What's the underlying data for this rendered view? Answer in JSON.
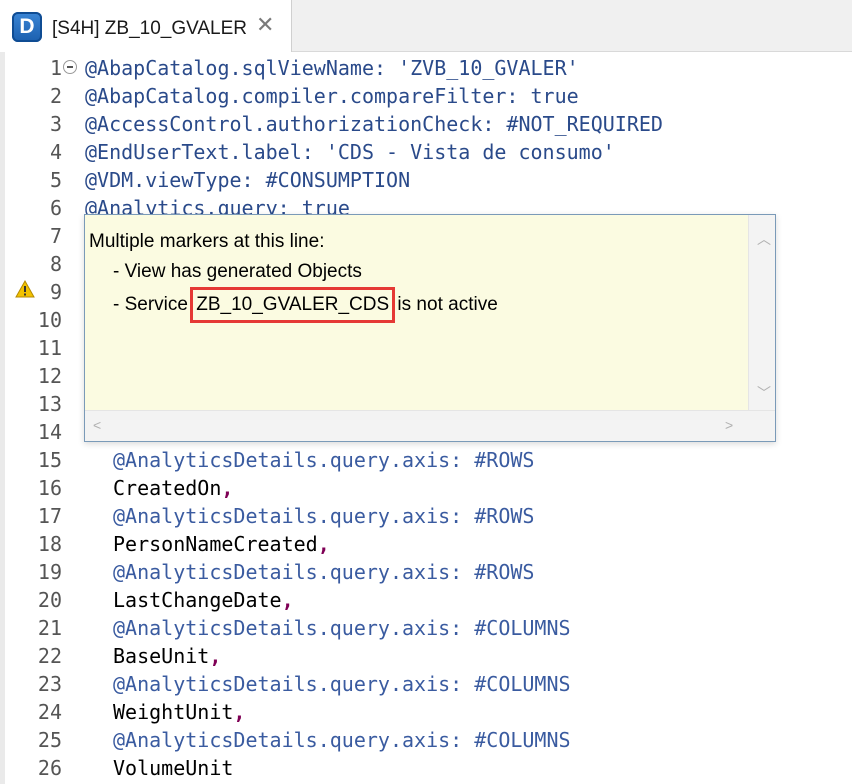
{
  "tab": {
    "icon": "D",
    "title": "[S4H] ZB_10_GVALER",
    "close": "✕"
  },
  "lines": [
    {
      "n": "1",
      "text": "@AbapCatalog.sqlViewName: 'ZVB_10_GVALER'",
      "indent": false
    },
    {
      "n": "2",
      "text": "@AbapCatalog.compiler.compareFilter: true",
      "indent": false
    },
    {
      "n": "3",
      "text": "@AccessControl.authorizationCheck: #NOT_REQUIRED",
      "indent": false
    },
    {
      "n": "4",
      "text": "@EndUserText.label: 'CDS - Vista de consumo'",
      "indent": false
    },
    {
      "n": "5",
      "text": "@VDM.viewType: #CONSUMPTION",
      "indent": false
    },
    {
      "n": "6",
      "text": "@Analytics.query: true",
      "indent": false
    },
    {
      "n": "7",
      "text": "",
      "indent": false
    },
    {
      "n": "8",
      "text": "",
      "indent": false
    },
    {
      "n": "9",
      "text": "",
      "indent": false
    },
    {
      "n": "10",
      "text": "",
      "indent": false
    },
    {
      "n": "11",
      "text": "",
      "indent": false
    },
    {
      "n": "12",
      "text": "",
      "indent": false
    },
    {
      "n": "13",
      "text": "",
      "indent": false
    },
    {
      "n": "14",
      "text": "",
      "indent": false
    },
    {
      "n": "15",
      "text": "@AnalyticsDetails.query.axis: #ROWS",
      "indent": true,
      "ann": true
    },
    {
      "n": "16",
      "text": "CreatedOn",
      "comma": ",",
      "indent": true
    },
    {
      "n": "17",
      "text": "@AnalyticsDetails.query.axis: #ROWS",
      "indent": true,
      "ann": true
    },
    {
      "n": "18",
      "text": "PersonNameCreated",
      "comma": ",",
      "indent": true
    },
    {
      "n": "19",
      "text": "@AnalyticsDetails.query.axis: #ROWS",
      "indent": true,
      "ann": true
    },
    {
      "n": "20",
      "text": "LastChangeDate",
      "comma": ",",
      "indent": true
    },
    {
      "n": "21",
      "text": "@AnalyticsDetails.query.axis: #COLUMNS",
      "indent": true,
      "ann": true
    },
    {
      "n": "22",
      "text": "BaseUnit",
      "comma": ",",
      "indent": true
    },
    {
      "n": "23",
      "text": "@AnalyticsDetails.query.axis: #COLUMNS",
      "indent": true,
      "ann": true
    },
    {
      "n": "24",
      "text": "WeightUnit",
      "comma": ",",
      "indent": true
    },
    {
      "n": "25",
      "text": "@AnalyticsDetails.query.axis: #COLUMNS",
      "indent": true,
      "ann": true
    },
    {
      "n": "26",
      "text": "VolumeUnit",
      "indent": true
    }
  ],
  "popup": {
    "heading": "Multiple markers at this line:",
    "item1": "- View has generated Objects",
    "item2_prefix": "- Service ",
    "item2_highlight": "ZB_10_GVALER_CDS",
    "item2_suffix": " is not active"
  },
  "colors": {
    "highlight_border": "#e53935",
    "popup_bg": "#fbfbe1"
  }
}
